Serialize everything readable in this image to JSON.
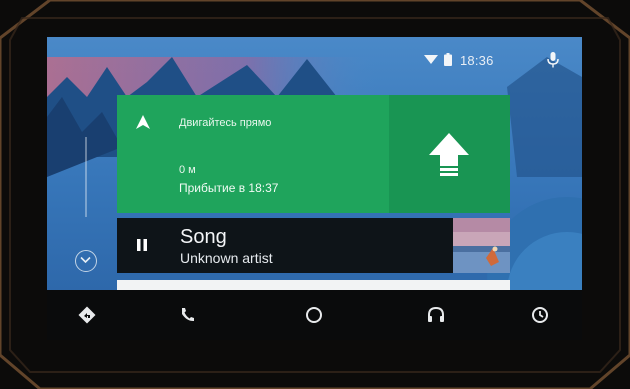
{
  "status": {
    "time": "18:36",
    "wifi_icon": "wifi-icon",
    "battery_icon": "battery-icon",
    "mic_icon": "mic-icon"
  },
  "navigation": {
    "instruction": "Двигайтесь прямо",
    "distance": "0 м",
    "arrival": "Прибытие в 18:37",
    "maneuver_icon": "arrow-up-icon",
    "accent": "#1fa45c"
  },
  "media": {
    "title": "Song",
    "artist": "Unknown artist",
    "state_icon": "pause-icon"
  },
  "navbar": {
    "items": [
      "navigation-icon",
      "phone-icon",
      "home-icon",
      "headphones-icon",
      "recents-icon"
    ]
  }
}
